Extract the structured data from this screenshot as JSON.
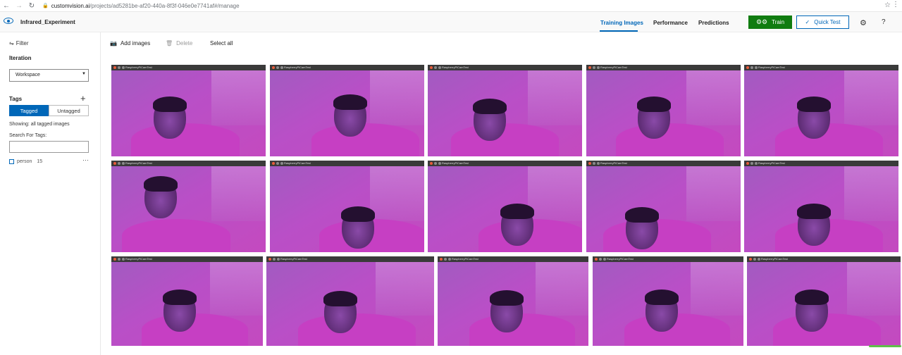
{
  "browser": {
    "url_domain": "customvision.ai",
    "url_path": "/projects/ad5281be-af20-440a-8f3f-046e0e7741af#/manage"
  },
  "header": {
    "project_name": "Infrared_Experiment",
    "tabs": [
      "Training Images",
      "Performance",
      "Predictions"
    ],
    "active_tab": "Training Images",
    "train_label": "Train",
    "quick_test_label": "Quick Test",
    "accent": "#0067b8",
    "train_color": "#107c10"
  },
  "sidebar": {
    "filter_label": "Filter",
    "iteration_heading": "Iteration",
    "iteration_value": "Workspace",
    "tags_heading": "Tags",
    "tagged_label": "Tagged",
    "untagged_label": "Untagged",
    "showing_text": "Showing: all tagged images",
    "search_label": "Search For Tags:",
    "search_value": "",
    "tags": [
      {
        "name": "person",
        "count": "15"
      }
    ]
  },
  "toolbar": {
    "add_images": "Add images",
    "delete": "Delete",
    "select_all": "Select all"
  },
  "grid": {
    "image_count": 15,
    "window_title": "RaspberryPiCamTest"
  }
}
